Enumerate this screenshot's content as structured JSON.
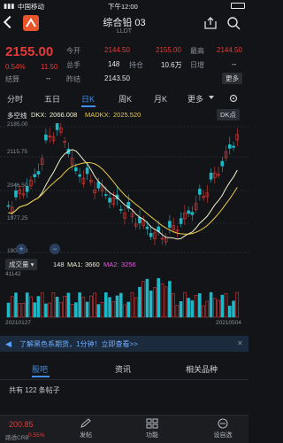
{
  "status_bar": {
    "carrier": "中国移动",
    "time": "下午12:00"
  },
  "header": {
    "title": "综合铅 03",
    "code": "LLDT",
    "back_icon": "chevron-left-icon",
    "share_icon": "share-icon",
    "search_icon": "search-icon"
  },
  "quote": {
    "price": "2155.00",
    "change_pct": "0.54%",
    "change": "11.50",
    "labels": {
      "open": "今开",
      "high": "最高",
      "total": "总手",
      "hold": "持仓",
      "day_add": "日增",
      "settle": "结算",
      "prev_settle": "昨结"
    },
    "open": "2144.50",
    "high": "2155.00",
    "total": "148",
    "hold": "10.6万",
    "day_add": "--",
    "settle": "--",
    "prev_settle": "2143.50",
    "red_price_right": "2144.50",
    "more_label": "更多"
  },
  "tabs": [
    "分时",
    "五日",
    "日K",
    "周K",
    "月K",
    "更多"
  ],
  "active_tab": "日K",
  "indicator": {
    "name": "多空线",
    "dkx_label": "DKX:",
    "dkx": "2066.008",
    "madkx_label": "MADKX:",
    "madkx": "2025.520",
    "dk_button": "DK点"
  },
  "chart": {
    "y_ticks": [
      "2185.00",
      "2115.75",
      "2046.50",
      "1977.25",
      "1908.00"
    ],
    "colors": {
      "up": "#e63a3a",
      "down": "#1fb8c6",
      "dkx": "#f5f0d0",
      "madkx": "#e8c94a"
    }
  },
  "volume": {
    "selector": "成交量",
    "value": "148",
    "ma1_label": "MA1:",
    "ma1": "3660",
    "ma2_label": "MA2:",
    "ma2": "3256",
    "max": "41142",
    "date_start": "20210127",
    "date_end": "20210504"
  },
  "banner": {
    "text": "了解黑色系期货，1分钟！立即查看>>"
  },
  "section_tabs": [
    "股吧",
    "资讯",
    "相关品种"
  ],
  "posts_text": "共有 122 条帖子",
  "footer": {
    "index_price": "200.85",
    "index_name": "路透CRB",
    "index_change": "0.55%",
    "post": "发帖",
    "func": "功能",
    "settings": "设自选"
  }
}
